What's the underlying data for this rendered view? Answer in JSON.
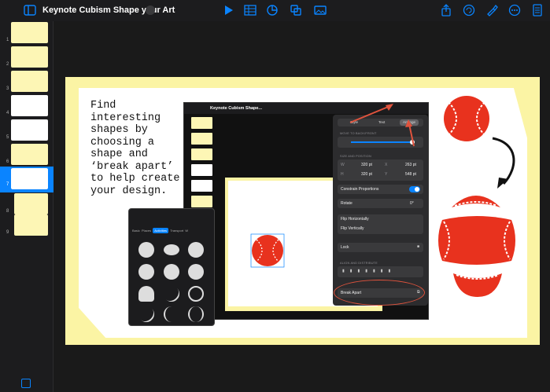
{
  "toolbar": {
    "title": "Keynote Cubism Shape your Art",
    "icons": [
      "sidebar-icon",
      "chevron-down-icon",
      "play-icon",
      "table-icon",
      "chart-icon",
      "shape-icon",
      "media-icon",
      "share-icon",
      "undo-icon",
      "format-brush-icon",
      "more-icon",
      "document-icon"
    ]
  },
  "slides": [
    {
      "num": "1",
      "style": "yellow"
    },
    {
      "num": "2",
      "style": "yellow"
    },
    {
      "num": "3",
      "style": "yellow"
    },
    {
      "num": "4",
      "style": "white"
    },
    {
      "num": "5",
      "style": "white"
    },
    {
      "num": "6",
      "style": "yellow"
    },
    {
      "num": "7",
      "style": "white",
      "selected": true
    },
    {
      "num": "8",
      "style": "yellow"
    },
    {
      "num": "9",
      "style": "yellow"
    }
  ],
  "slide": {
    "caption": "Find\ninteresting\nshapes by\nchoosing a\nshape and\n‘break apart’\nto help create\nyour design."
  },
  "screenshot": {
    "title": "Keynote Cubism Shape...",
    "tabs": [
      "Style",
      "Text",
      "Arrange"
    ],
    "active_tab": "Arrange",
    "move_label": "MOVE TO BACK/FRONT",
    "size_label": "SIZE AND POSITION",
    "w_label": "W",
    "w_value": "320 pt",
    "h_label": "H",
    "h_value": "320 pt",
    "x_label": "X",
    "x_value": "263 pt",
    "y_label": "Y",
    "y_value": "548 pt",
    "constrain_label": "Constrain Proportions",
    "rotate_label": "Rotate",
    "rotate_value": "0°",
    "flip_h": "Flip Horizontally",
    "flip_v": "Flip Vertically",
    "lock": "Lock",
    "align_label": "ALIGN AND DISTRIBUTE",
    "break_apart": "Break Apart"
  },
  "phone": {
    "tabs": [
      "Basic",
      "Places",
      "Activities",
      "Transport",
      "W"
    ],
    "active_tab": "Activities"
  },
  "colors": {
    "accent": "#0a84ff",
    "baseball": "#e8321e",
    "slide_yellow": "#fbf4a4",
    "annotation": "#e0533d"
  }
}
